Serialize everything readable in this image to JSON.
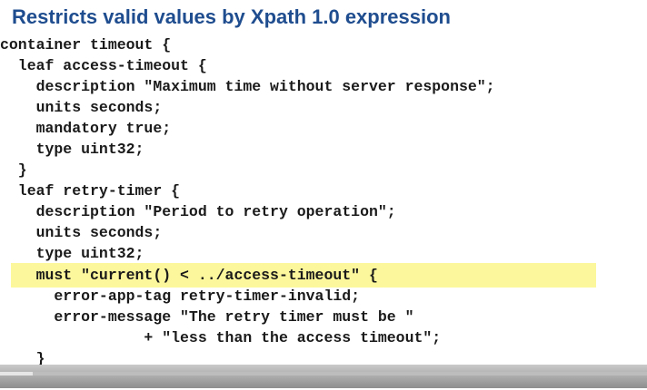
{
  "slide": {
    "title": "Restricts valid values by Xpath 1.0 expression",
    "code_lines": [
      "container timeout {",
      "  leaf access-timeout {",
      "    description \"Maximum time without server response\";",
      "    units seconds;",
      "    mandatory true;",
      "    type uint32;",
      "  }",
      "  leaf retry-timer {",
      "    description \"Period to retry operation\";",
      "    units seconds;",
      "    type uint32;",
      "    must \"current() < ../access-timeout\" {",
      "      error-app-tag retry-timer-invalid;",
      "      error-message \"The retry timer must be \"",
      "                + \"less than the access timeout\";",
      "    }",
      "}"
    ],
    "highlight_color": "#fcf79c",
    "title_color": "#1f4d8f"
  },
  "player": {
    "progress_fraction": 0.05
  }
}
